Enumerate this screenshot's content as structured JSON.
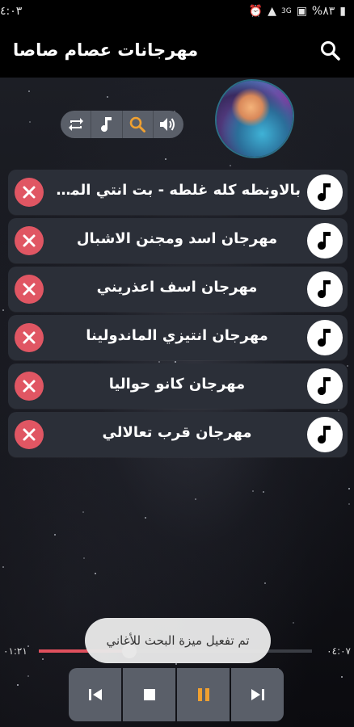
{
  "status": {
    "time": "٤:٠٣",
    "battery": "%٨٣"
  },
  "header": {
    "title": "مهرجانات عصام صاصا"
  },
  "songs": [
    {
      "title": "بالاونطه كله غلطه - بت انتي المطرب"
    },
    {
      "title": "مهرجان اسد ومجنن الاشبال"
    },
    {
      "title": "مهرجان اسف اعذريني"
    },
    {
      "title": "مهرجان انتيزي الماندولينا"
    },
    {
      "title": "مهرجان كانو حواليا"
    },
    {
      "title": "مهرجان قرب تعالالي"
    }
  ],
  "player": {
    "elapsed": "٠١:٢١",
    "duration": "٠٤:٠٧",
    "progress_fraction": 0.33,
    "toast": "تم تفعيل ميزة البحث للأغاني"
  },
  "colors": {
    "accent": "#e0505d",
    "search_accent": "#f0a030",
    "pause_accent": "#f0a030"
  }
}
